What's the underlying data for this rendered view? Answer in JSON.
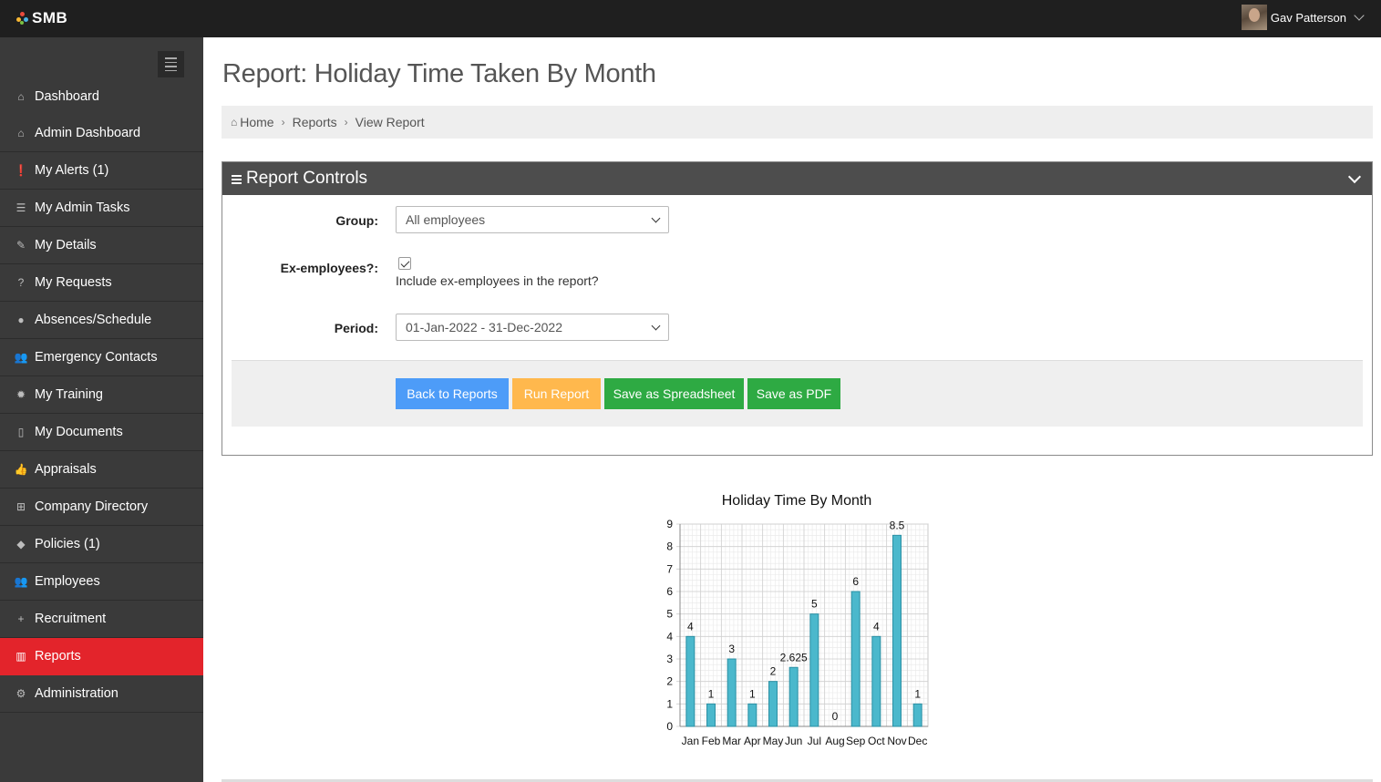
{
  "topbar": {
    "logo_text": "SMB",
    "user_name": "Gav Patterson"
  },
  "sidebar": {
    "items": [
      {
        "label": "Dashboard",
        "icon": "home-icon",
        "glyph": "⌂"
      },
      {
        "label": "Admin Dashboard",
        "icon": "home-icon",
        "glyph": "⌂"
      },
      {
        "label": "My Alerts (1)",
        "icon": "alert-icon",
        "glyph": "❗"
      },
      {
        "label": "My Admin Tasks",
        "icon": "tasks-icon",
        "glyph": "☰"
      },
      {
        "label": "My Details",
        "icon": "edit-icon",
        "glyph": "✎"
      },
      {
        "label": "My Requests",
        "icon": "question-icon",
        "glyph": "?"
      },
      {
        "label": "Absences/Schedule",
        "icon": "globe-icon",
        "glyph": "●"
      },
      {
        "label": "Emergency Contacts",
        "icon": "users-icon",
        "glyph": "👥"
      },
      {
        "label": "My Training",
        "icon": "cog-icon",
        "glyph": "✹"
      },
      {
        "label": "My Documents",
        "icon": "document-icon",
        "glyph": "▯"
      },
      {
        "label": "Appraisals",
        "icon": "thumbs-up-icon",
        "glyph": "👍"
      },
      {
        "label": "Company Directory",
        "icon": "sitemap-icon",
        "glyph": "⊞"
      },
      {
        "label": "Policies (1)",
        "icon": "tags-icon",
        "glyph": "◆"
      },
      {
        "label": "Employees",
        "icon": "users-icon",
        "glyph": "👥"
      },
      {
        "label": "Recruitment",
        "icon": "plus-circle-icon",
        "glyph": "+"
      },
      {
        "label": "Reports",
        "icon": "bar-chart-icon",
        "glyph": "▥",
        "active": true
      },
      {
        "label": "Administration",
        "icon": "cogs-icon",
        "glyph": "⚙"
      }
    ]
  },
  "page": {
    "title": "Report: Holiday Time Taken By Month"
  },
  "breadcrumb": {
    "home": "Home",
    "reports": "Reports",
    "current": "View Report"
  },
  "controls": {
    "title": "Report Controls",
    "group_label": "Group:",
    "group_value": "All employees",
    "ex_label": "Ex-employees?:",
    "ex_checked": true,
    "ex_text": "Include ex-employees in the report?",
    "period_label": "Period:",
    "period_value": "01-Jan-2022 - 31-Dec-2022",
    "btn_back": "Back to Reports",
    "btn_run": "Run Report",
    "btn_spreadsheet": "Save as Spreadsheet",
    "btn_pdf": "Save as PDF"
  },
  "colors": {
    "active": "#e3242b",
    "bar": "#4bb8cc",
    "blue": "#4d9cf8",
    "orange": "#ffb84d",
    "green": "#2eaa43"
  },
  "chart_data": {
    "type": "bar",
    "title": "Holiday Time By Month",
    "categories": [
      "Jan",
      "Feb",
      "Mar",
      "Apr",
      "May",
      "Jun",
      "Jul",
      "Aug",
      "Sep",
      "Oct",
      "Nov",
      "Dec"
    ],
    "values": [
      4,
      1,
      3,
      1,
      2,
      2.625,
      5,
      0,
      6,
      4,
      8.5,
      1
    ],
    "data_labels": [
      "4",
      "1",
      "3",
      "1",
      "2",
      "2.625",
      "5",
      "0",
      "6",
      "4",
      "8.5",
      "1"
    ],
    "yticks": [
      "0",
      "1",
      "2",
      "3",
      "4",
      "5",
      "6",
      "7",
      "8",
      "9"
    ],
    "ylim": [
      0,
      9
    ],
    "grid": true,
    "xlabel": "",
    "ylabel": ""
  }
}
